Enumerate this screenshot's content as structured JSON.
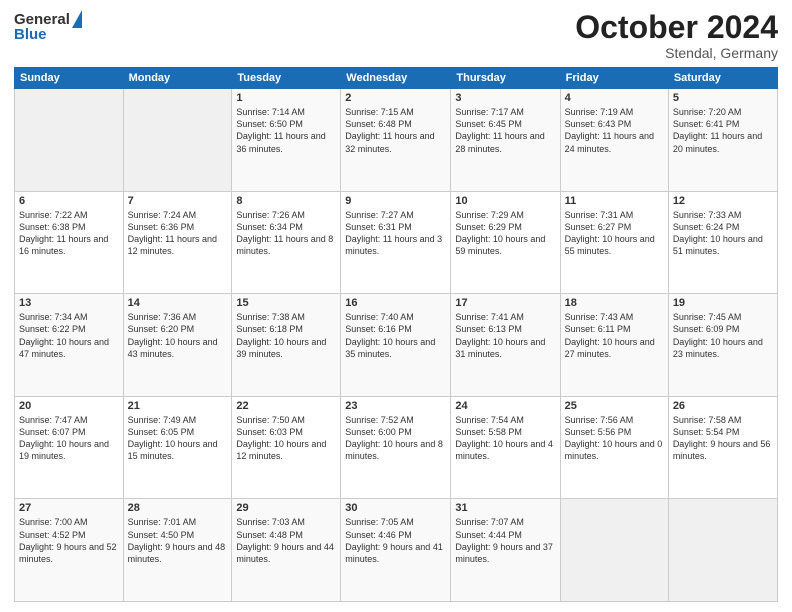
{
  "header": {
    "logo_general": "General",
    "logo_blue": "Blue",
    "month": "October 2024",
    "location": "Stendal, Germany"
  },
  "days": [
    "Sunday",
    "Monday",
    "Tuesday",
    "Wednesday",
    "Thursday",
    "Friday",
    "Saturday"
  ],
  "weeks": [
    [
      {
        "num": "",
        "sunrise": "",
        "sunset": "",
        "daylight": ""
      },
      {
        "num": "",
        "sunrise": "",
        "sunset": "",
        "daylight": ""
      },
      {
        "num": "1",
        "sunrise": "Sunrise: 7:14 AM",
        "sunset": "Sunset: 6:50 PM",
        "daylight": "Daylight: 11 hours and 36 minutes."
      },
      {
        "num": "2",
        "sunrise": "Sunrise: 7:15 AM",
        "sunset": "Sunset: 6:48 PM",
        "daylight": "Daylight: 11 hours and 32 minutes."
      },
      {
        "num": "3",
        "sunrise": "Sunrise: 7:17 AM",
        "sunset": "Sunset: 6:45 PM",
        "daylight": "Daylight: 11 hours and 28 minutes."
      },
      {
        "num": "4",
        "sunrise": "Sunrise: 7:19 AM",
        "sunset": "Sunset: 6:43 PM",
        "daylight": "Daylight: 11 hours and 24 minutes."
      },
      {
        "num": "5",
        "sunrise": "Sunrise: 7:20 AM",
        "sunset": "Sunset: 6:41 PM",
        "daylight": "Daylight: 11 hours and 20 minutes."
      }
    ],
    [
      {
        "num": "6",
        "sunrise": "Sunrise: 7:22 AM",
        "sunset": "Sunset: 6:38 PM",
        "daylight": "Daylight: 11 hours and 16 minutes."
      },
      {
        "num": "7",
        "sunrise": "Sunrise: 7:24 AM",
        "sunset": "Sunset: 6:36 PM",
        "daylight": "Daylight: 11 hours and 12 minutes."
      },
      {
        "num": "8",
        "sunrise": "Sunrise: 7:26 AM",
        "sunset": "Sunset: 6:34 PM",
        "daylight": "Daylight: 11 hours and 8 minutes."
      },
      {
        "num": "9",
        "sunrise": "Sunrise: 7:27 AM",
        "sunset": "Sunset: 6:31 PM",
        "daylight": "Daylight: 11 hours and 3 minutes."
      },
      {
        "num": "10",
        "sunrise": "Sunrise: 7:29 AM",
        "sunset": "Sunset: 6:29 PM",
        "daylight": "Daylight: 10 hours and 59 minutes."
      },
      {
        "num": "11",
        "sunrise": "Sunrise: 7:31 AM",
        "sunset": "Sunset: 6:27 PM",
        "daylight": "Daylight: 10 hours and 55 minutes."
      },
      {
        "num": "12",
        "sunrise": "Sunrise: 7:33 AM",
        "sunset": "Sunset: 6:24 PM",
        "daylight": "Daylight: 10 hours and 51 minutes."
      }
    ],
    [
      {
        "num": "13",
        "sunrise": "Sunrise: 7:34 AM",
        "sunset": "Sunset: 6:22 PM",
        "daylight": "Daylight: 10 hours and 47 minutes."
      },
      {
        "num": "14",
        "sunrise": "Sunrise: 7:36 AM",
        "sunset": "Sunset: 6:20 PM",
        "daylight": "Daylight: 10 hours and 43 minutes."
      },
      {
        "num": "15",
        "sunrise": "Sunrise: 7:38 AM",
        "sunset": "Sunset: 6:18 PM",
        "daylight": "Daylight: 10 hours and 39 minutes."
      },
      {
        "num": "16",
        "sunrise": "Sunrise: 7:40 AM",
        "sunset": "Sunset: 6:16 PM",
        "daylight": "Daylight: 10 hours and 35 minutes."
      },
      {
        "num": "17",
        "sunrise": "Sunrise: 7:41 AM",
        "sunset": "Sunset: 6:13 PM",
        "daylight": "Daylight: 10 hours and 31 minutes."
      },
      {
        "num": "18",
        "sunrise": "Sunrise: 7:43 AM",
        "sunset": "Sunset: 6:11 PM",
        "daylight": "Daylight: 10 hours and 27 minutes."
      },
      {
        "num": "19",
        "sunrise": "Sunrise: 7:45 AM",
        "sunset": "Sunset: 6:09 PM",
        "daylight": "Daylight: 10 hours and 23 minutes."
      }
    ],
    [
      {
        "num": "20",
        "sunrise": "Sunrise: 7:47 AM",
        "sunset": "Sunset: 6:07 PM",
        "daylight": "Daylight: 10 hours and 19 minutes."
      },
      {
        "num": "21",
        "sunrise": "Sunrise: 7:49 AM",
        "sunset": "Sunset: 6:05 PM",
        "daylight": "Daylight: 10 hours and 15 minutes."
      },
      {
        "num": "22",
        "sunrise": "Sunrise: 7:50 AM",
        "sunset": "Sunset: 6:03 PM",
        "daylight": "Daylight: 10 hours and 12 minutes."
      },
      {
        "num": "23",
        "sunrise": "Sunrise: 7:52 AM",
        "sunset": "Sunset: 6:00 PM",
        "daylight": "Daylight: 10 hours and 8 minutes."
      },
      {
        "num": "24",
        "sunrise": "Sunrise: 7:54 AM",
        "sunset": "Sunset: 5:58 PM",
        "daylight": "Daylight: 10 hours and 4 minutes."
      },
      {
        "num": "25",
        "sunrise": "Sunrise: 7:56 AM",
        "sunset": "Sunset: 5:56 PM",
        "daylight": "Daylight: 10 hours and 0 minutes."
      },
      {
        "num": "26",
        "sunrise": "Sunrise: 7:58 AM",
        "sunset": "Sunset: 5:54 PM",
        "daylight": "Daylight: 9 hours and 56 minutes."
      }
    ],
    [
      {
        "num": "27",
        "sunrise": "Sunrise: 7:00 AM",
        "sunset": "Sunset: 4:52 PM",
        "daylight": "Daylight: 9 hours and 52 minutes."
      },
      {
        "num": "28",
        "sunrise": "Sunrise: 7:01 AM",
        "sunset": "Sunset: 4:50 PM",
        "daylight": "Daylight: 9 hours and 48 minutes."
      },
      {
        "num": "29",
        "sunrise": "Sunrise: 7:03 AM",
        "sunset": "Sunset: 4:48 PM",
        "daylight": "Daylight: 9 hours and 44 minutes."
      },
      {
        "num": "30",
        "sunrise": "Sunrise: 7:05 AM",
        "sunset": "Sunset: 4:46 PM",
        "daylight": "Daylight: 9 hours and 41 minutes."
      },
      {
        "num": "31",
        "sunrise": "Sunrise: 7:07 AM",
        "sunset": "Sunset: 4:44 PM",
        "daylight": "Daylight: 9 hours and 37 minutes."
      },
      {
        "num": "",
        "sunrise": "",
        "sunset": "",
        "daylight": ""
      },
      {
        "num": "",
        "sunrise": "",
        "sunset": "",
        "daylight": ""
      }
    ]
  ]
}
